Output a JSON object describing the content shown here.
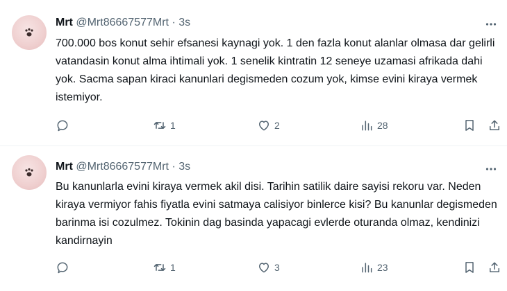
{
  "tweets": [
    {
      "name": "Mrt",
      "handle": "@Mrt86667577Mrt",
      "dot": "·",
      "time": "3s",
      "text": "700.000 bos konut sehir efsanesi kaynagi yok. 1 den fazla konut alanlar olmasa dar gelirli vatandasin konut alma ihtimali yok. 1 senelik kintratin 12 seneye uzamasi afrikada dahi yok. Sacma sapan kiraci kanunlari degismeden cozum yok, kimse evini kiraya vermek istemiyor.",
      "replies": "",
      "retweets": "1",
      "likes": "2",
      "views": "28"
    },
    {
      "name": "Mrt",
      "handle": "@Mrt86667577Mrt",
      "dot": "·",
      "time": "3s",
      "text": "Bu kanunlarla evini kiraya vermek akil disi. Tarihin satilik daire sayisi rekoru var. Neden kiraya vermiyor fahis fiyatla evini satmaya calisiyor binlerce kisi? Bu kanunlar degismeden barinma isi cozulmez. Tokinin dag basinda yapacagi evlerde oturanda olmaz, kendinizi kandirnayin",
      "replies": "",
      "retweets": "1",
      "likes": "3",
      "views": "23"
    }
  ],
  "icons": {
    "avatar": "paw-icon",
    "more": "more-horizontal-icon",
    "reply": "reply-icon",
    "retweet": "retweet-icon",
    "like": "heart-icon",
    "views": "views-icon",
    "bookmark": "bookmark-icon",
    "share": "share-icon"
  },
  "colors": {
    "text": "#0f1419",
    "secondary": "#536471",
    "divider": "#eff3f4",
    "avatar_bg": "#efcfcf"
  }
}
